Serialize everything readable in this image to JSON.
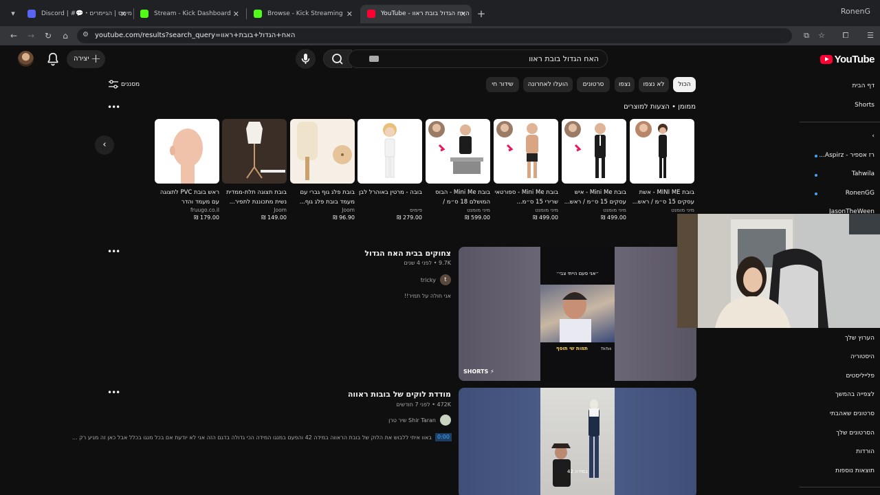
{
  "browser": {
    "tabs": [
      {
        "title": "Discord | #💬・שיחות&מימס | הגיימרים",
        "favicon_color": "#5865f2",
        "active": false
      },
      {
        "title": "Stream - Kick Dashboard",
        "favicon_color": "#53fc18",
        "active": false
      },
      {
        "title": "Browse - Kick Streaming",
        "favicon_color": "#53fc18",
        "active": false
      },
      {
        "title": "YouTube - האח הגדול בובת ראוו",
        "favicon_color": "#ff0033",
        "active": true
      }
    ],
    "new_tab_label": "+",
    "profile_label": "RonenG",
    "url": "youtube.com/results?search_query=האח+הגדול+בובת+ראוו"
  },
  "masthead": {
    "logo_text": "YouTube",
    "search_query": "האח הגדול בובת ראוו",
    "create_label": "יצירה"
  },
  "filters": {
    "filters_label": "מסננים",
    "chips": [
      {
        "label": "הכול",
        "active": true
      },
      {
        "label": "לא נצפו",
        "active": false
      },
      {
        "label": "נצפו",
        "active": false
      },
      {
        "label": "סרטונים",
        "active": false
      },
      {
        "label": "הועלו לאחרונה",
        "active": false
      },
      {
        "label": "שידור חי",
        "active": false
      }
    ]
  },
  "shelf": {
    "title": "ממומן • הצעות למוצרים",
    "products": [
      {
        "title": "בובת MINI ME - אשת עסקים 15 ס״מ / ראש...",
        "store": "מיני מומנט",
        "price": "",
        "thumb": "woman-figure"
      },
      {
        "title": "בובת Mini Me - איש עסקים 15 ס״מ / ראש...",
        "store": "מיני מומנט",
        "price": "499.00 ₪",
        "thumb": "man-suit"
      },
      {
        "title": "בובת Mini Me - ספורטאי שרירי 15 ס״מ...",
        "store": "מיני מומנט",
        "price": "499.00 ₪",
        "thumb": "man-shirtless"
      },
      {
        "title": "בובת Mini Me - הבוס המושלם 18 ס״מ / ראש...",
        "store": "מיני מומנט",
        "price": "599.00 ₪",
        "thumb": "man-desk"
      },
      {
        "title": "בובה - מרטין באוהרל לבן",
        "store": "פימיס",
        "price": "279.00 ₪",
        "thumb": "doll-white"
      },
      {
        "title": "בובת פלג גוף גברי עם מעמד בובת פלג גוף...",
        "store": "Joom",
        "price": "96.90 ₪",
        "thumb": "mannequin-wood"
      },
      {
        "title": "בובת תצוגה תלת-ממדית נשית מתכוננת לתפיר...",
        "store": "Joom",
        "price": "149.00 ₪",
        "thumb": "dress-form"
      },
      {
        "title": "ראש בובת PVC לתצוגה עם מעמד והדר",
        "store": "fruugo.co.il",
        "price": "179.00 ₪",
        "thumb": "pvc-head"
      }
    ]
  },
  "results": [
    {
      "title": "צחוקים בבית האח הגדול",
      "meta": "9.7K • לפני 4 שנים",
      "channel": "tricky",
      "channel_initial": "t",
      "description": "אני חולה על תמיר!!",
      "badge": "SHORTS",
      "overlay_top": "״אני פעם הייתי צבי״",
      "overlay_bottom": "תמות שי תוסף",
      "watermark": "TikTok"
    },
    {
      "title": "מודדת לוקים של בובות ראווה",
      "meta": "472K • לפני 7 חודשים",
      "channel": "שיר טרן Shir Taran",
      "timestamp": "0:00",
      "description": "באוו איתי ללבוש את הלוק של בובת הראווה במידה 42 והפעם במנגו המידה הכי גדולה בדגם הזה אני לא יודעת אם בכל מנגו בכלל אבל כאן זה מגיע רק ...",
      "overlay_bottom": "במידה 42"
    }
  ],
  "guide": {
    "top": [
      "דף הבית",
      "Shorts"
    ],
    "subscriptions": [
      "רז אספיר - Aspirz...",
      "Tahwila",
      "RonenGG",
      "JasonTheWeen"
    ],
    "you": [
      "הערוץ שלך",
      "היסטוריה",
      "פלייליסטים",
      "לצפייה בהמשך",
      "סרטונים שאהבתי",
      "הסרטונים שלך",
      "הורדות",
      "תוצאות נוספות"
    ]
  },
  "colors": {
    "background": "#0f0f0f",
    "accent_red": "#ff0033",
    "link_blue": "#3ea6ff",
    "chip_bg": "#272727"
  }
}
